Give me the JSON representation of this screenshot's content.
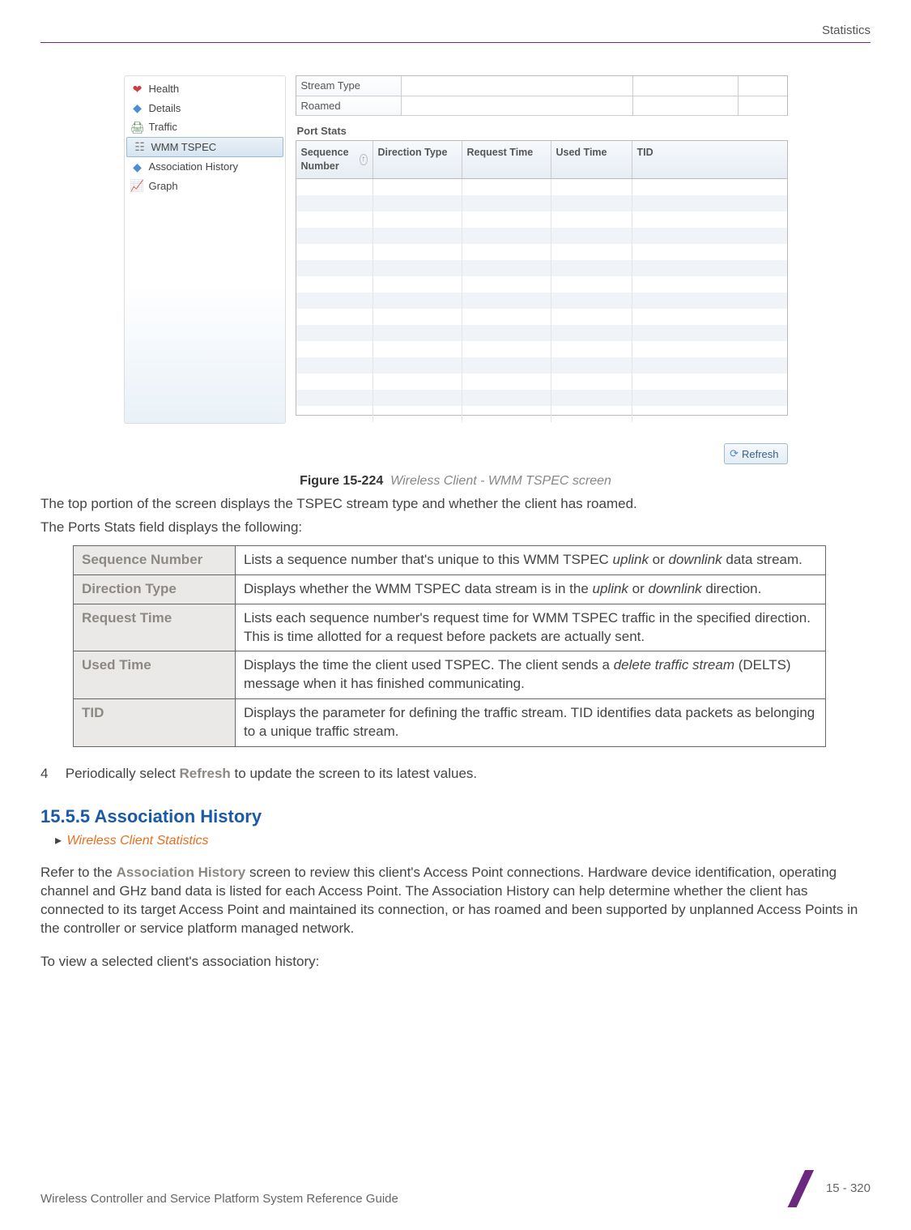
{
  "header": {
    "section_name": "Statistics"
  },
  "screenshot": {
    "nav": {
      "items": [
        {
          "label": "Health",
          "icon": "heart-icon",
          "icon_glyph": "❤",
          "color": "#d03c3c"
        },
        {
          "label": "Details",
          "icon": "details-icon",
          "icon_glyph": "◆",
          "color": "#4b8dd6"
        },
        {
          "label": "Traffic",
          "icon": "traffic-icon",
          "icon_glyph": "🖨",
          "color": "#5a8b5a"
        },
        {
          "label": "WMM TSPEC",
          "icon": "wmm-icon",
          "icon_glyph": "☷",
          "color": "#7a7a7a",
          "selected": true
        },
        {
          "label": "Association History",
          "icon": "assoc-icon",
          "icon_glyph": "◆",
          "color": "#4b8dd6"
        },
        {
          "label": "Graph",
          "icon": "graph-icon",
          "icon_glyph": "📈",
          "color": "#5fa8c7"
        }
      ]
    },
    "summary": {
      "rows": [
        {
          "label": "Stream Type",
          "value": ""
        },
        {
          "label": "Roamed",
          "value": ""
        }
      ]
    },
    "port_stats": {
      "legend": "Port Stats",
      "columns": {
        "seq": "Sequence Number",
        "dir": "Direction Type",
        "req": "Request Time",
        "used": "Used Time",
        "tid": "TID"
      },
      "sort_indicator": "↑",
      "row_count": 15
    },
    "refresh_label": "Refresh"
  },
  "figure": {
    "label": "Figure 15-224",
    "title": "Wireless Client - WMM TSPEC screen"
  },
  "para1": "The top portion of the screen displays the TSPEC stream type and whether the client has roamed.",
  "para2": "The Ports Stats field displays the following:",
  "definitions": [
    {
      "term": "Sequence Number",
      "desc_pre": "Lists a sequence number that's unique to this WMM TSPEC ",
      "italic1": "uplink",
      "mid1": " or ",
      "italic2": "downlink",
      "desc_post": " data stream."
    },
    {
      "term": "Direction Type",
      "desc_pre": "Displays whether the WMM TSPEC data stream is in the ",
      "italic1": "uplink",
      "mid1": " or ",
      "italic2": "downlink",
      "desc_post": " direction."
    },
    {
      "term": "Request Time",
      "desc_pre": "Lists each sequence number's request time for WMM TSPEC traffic in the specified direction. This is time allotted for a request before packets are actually sent.",
      "italic1": "",
      "mid1": "",
      "italic2": "",
      "desc_post": ""
    },
    {
      "term": "Used Time",
      "desc_pre": "Displays the time the client used TSPEC. The client sends a ",
      "italic1": "delete traffic stream",
      "mid1": " (DELTS) message when it has finished communicating.",
      "italic2": "",
      "desc_post": ""
    },
    {
      "term": "TID",
      "desc_pre": "Displays the parameter for defining the traffic stream. TID identifies data packets as belonging to a unique traffic stream.",
      "italic1": "",
      "mid1": "",
      "italic2": "",
      "desc_post": ""
    }
  ],
  "step4": {
    "num": "4",
    "pre": "Periodically select ",
    "bold": "Refresh",
    "post": " to update the screen to its latest values."
  },
  "section": {
    "heading": "15.5.5 Association History",
    "breadcrumb_arrow": "▸",
    "breadcrumb": "Wireless Client Statistics",
    "para_pre": "Refer to the ",
    "para_bold": "Association History",
    "para_post": " screen to review this client's Access Point connections. Hardware device identification, operating channel and GHz band data is listed for each Access Point. The Association History can help determine whether the client has connected to its target Access Point and maintained its connection, or has roamed and been supported by unplanned Access Points in the controller or service platform managed network.",
    "para2": "To view a selected client's association history:"
  },
  "footer": {
    "book_title": "Wireless Controller and Service Platform System Reference Guide",
    "page": "15 - 320"
  }
}
